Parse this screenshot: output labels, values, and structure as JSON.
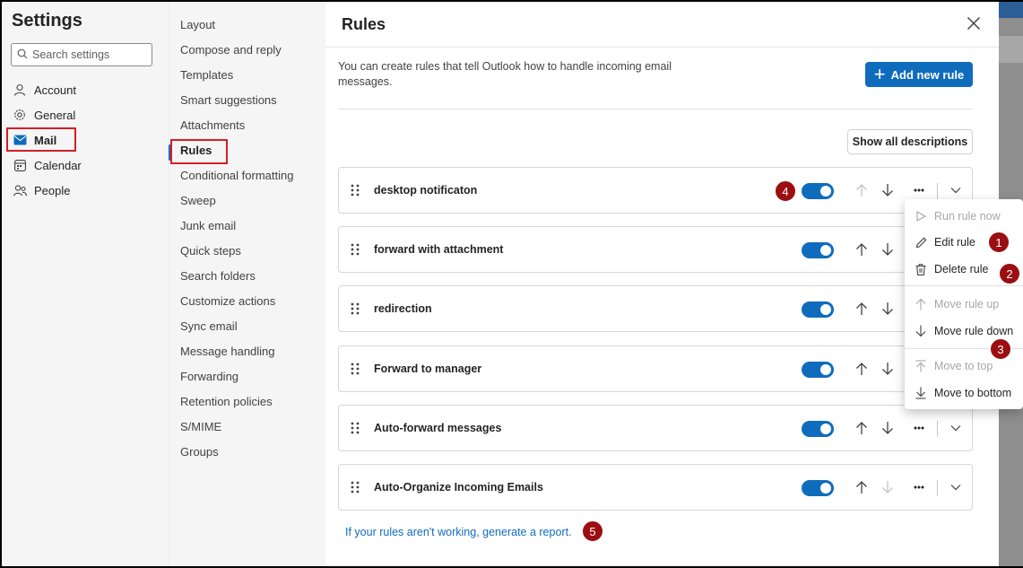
{
  "settings": {
    "title": "Settings",
    "search_placeholder": "Search settings",
    "nav": [
      {
        "label": "Account",
        "icon": "person-icon"
      },
      {
        "label": "General",
        "icon": "gear-icon"
      },
      {
        "label": "Mail",
        "icon": "mail-icon"
      },
      {
        "label": "Calendar",
        "icon": "calendar-icon"
      },
      {
        "label": "People",
        "icon": "people-icon"
      }
    ],
    "active_nav": "Mail"
  },
  "mail_nav": {
    "items": [
      "Layout",
      "Compose and reply",
      "Templates",
      "Smart suggestions",
      "Attachments",
      "Rules",
      "Conditional formatting",
      "Sweep",
      "Junk email",
      "Quick steps",
      "Search folders",
      "Customize actions",
      "Sync email",
      "Message handling",
      "Forwarding",
      "Retention policies",
      "S/MIME",
      "Groups"
    ],
    "active": "Rules"
  },
  "rules_panel": {
    "title": "Rules",
    "description": "You can create rules that tell Outlook how to handle incoming email messages.",
    "add_button": "Add new rule",
    "show_all_button": "Show all descriptions",
    "report_link": "If your rules aren't working, generate a report.",
    "rules": [
      {
        "name": "desktop notificaton",
        "enabled": true
      },
      {
        "name": "forward with attachment",
        "enabled": true
      },
      {
        "name": "redirection",
        "enabled": true
      },
      {
        "name": "Forward to manager",
        "enabled": true
      },
      {
        "name": "Auto-forward messages",
        "enabled": true
      },
      {
        "name": "Auto-Organize Incoming Emails",
        "enabled": true
      }
    ]
  },
  "context_menu": {
    "items": [
      {
        "label": "Run rule now",
        "icon": "play-icon",
        "disabled": true
      },
      {
        "label": "Edit rule",
        "icon": "pencil-icon",
        "disabled": false
      },
      {
        "label": "Delete rule",
        "icon": "trash-icon",
        "disabled": false
      },
      {
        "label": "Move rule up",
        "icon": "arrow-up-icon",
        "disabled": true
      },
      {
        "label": "Move rule down",
        "icon": "arrow-down-icon",
        "disabled": false
      },
      {
        "label": "Move to top",
        "icon": "arrow-to-top-icon",
        "disabled": true
      },
      {
        "label": "Move to bottom",
        "icon": "arrow-to-bottom-icon",
        "disabled": false
      }
    ]
  },
  "annotations": [
    "1",
    "2",
    "3",
    "4",
    "5"
  ],
  "colors": {
    "accent": "#0f6cbd",
    "highlight_border": "#d11f26",
    "badge": "#9b0e12"
  }
}
